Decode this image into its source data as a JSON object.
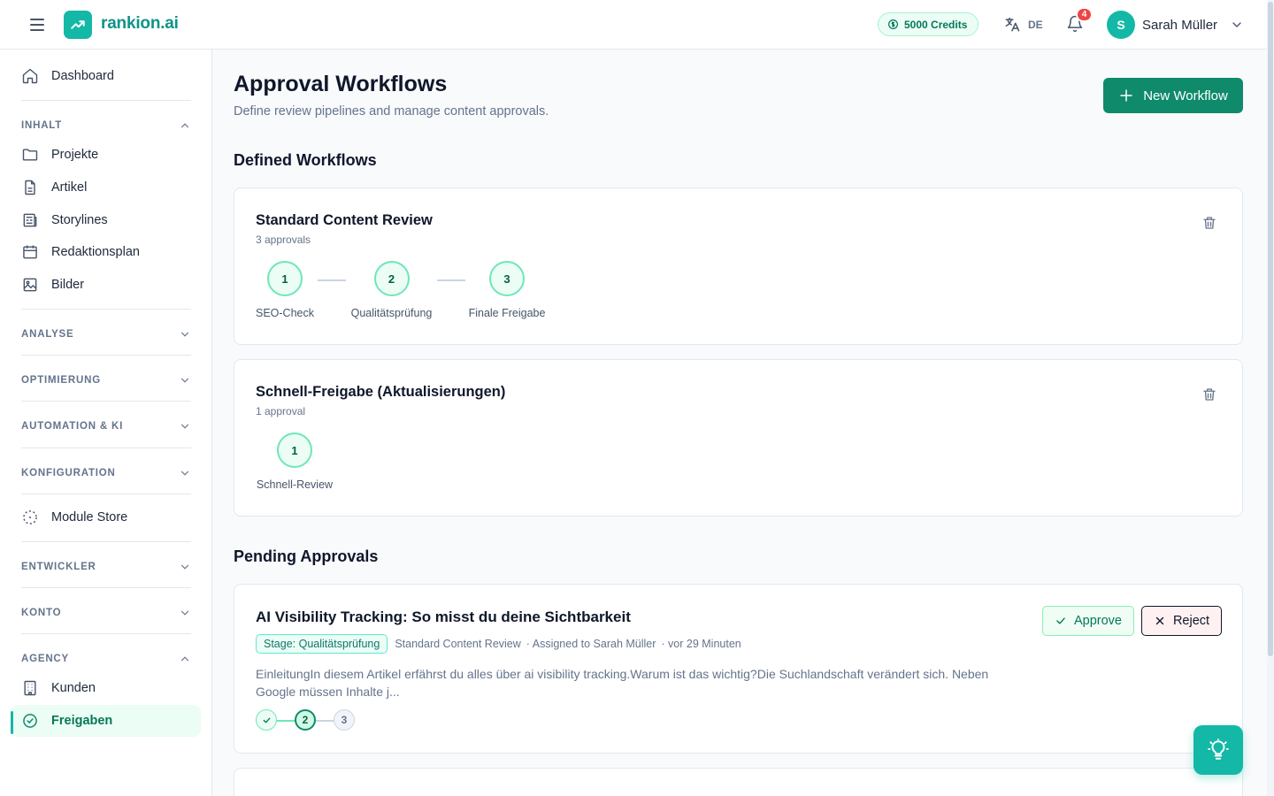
{
  "app": {
    "logo_text": "rankion.ai",
    "credits": "5000 Credits",
    "language": "DE",
    "notifications_count": "4",
    "user": {
      "initial": "S",
      "name": "Sarah Müller"
    }
  },
  "sidebar": {
    "dashboard": "Dashboard",
    "sections": {
      "inhalt": "INHALT",
      "analyse": "ANALYSE",
      "optimierung": "OPTIMIERUNG",
      "automation": "AUTOMATION & KI",
      "konfiguration": "KONFIGURATION",
      "entwickler": "ENTWICKLER",
      "konto": "KONTO",
      "agency": "AGENCY"
    },
    "inhalt_items": [
      "Projekte",
      "Artikel",
      "Storylines",
      "Redaktionsplan",
      "Bilder"
    ],
    "module_store": "Module Store",
    "agency_items": [
      "Kunden",
      "Freigaben"
    ]
  },
  "page": {
    "title": "Approval Workflows",
    "subtitle": "Define review pipelines and manage content approvals.",
    "new_button": "New Workflow",
    "defined_title": "Defined Workflows",
    "pending_title": "Pending Approvals"
  },
  "workflows": [
    {
      "name": "Standard Content Review",
      "count": "3 approvals",
      "steps": [
        {
          "num": "1",
          "label": "SEO-Check"
        },
        {
          "num": "2",
          "label": "Qualitätsprüfung"
        },
        {
          "num": "3",
          "label": "Finale Freigabe"
        }
      ]
    },
    {
      "name": "Schnell-Freigabe (Aktualisierungen)",
      "count": "1 approval",
      "steps": [
        {
          "num": "1",
          "label": "Schnell-Review"
        }
      ]
    }
  ],
  "pending": [
    {
      "title": "AI Visibility Tracking: So misst du deine Sichtbarkeit",
      "stage": "Stage: Qualitätsprüfung",
      "workflow": "Standard Content Review",
      "assigned": "· Assigned to Sarah Müller",
      "time": "· vor 29 Minuten",
      "excerpt": "EinleitungIn diesem Artikel erfährst du alles über ai visibility tracking.Warum ist das wichtig?Die Suchlandschaft verändert sich. Neben Google müssen Inhalte j...",
      "progress": {
        "current_step": "2",
        "last_step": "3"
      },
      "approve": "Approve",
      "reject": "Reject"
    }
  ],
  "colors": {
    "brand": "#14b8a6",
    "primary_button": "#0f8a6b",
    "notification": "#ef4444"
  }
}
